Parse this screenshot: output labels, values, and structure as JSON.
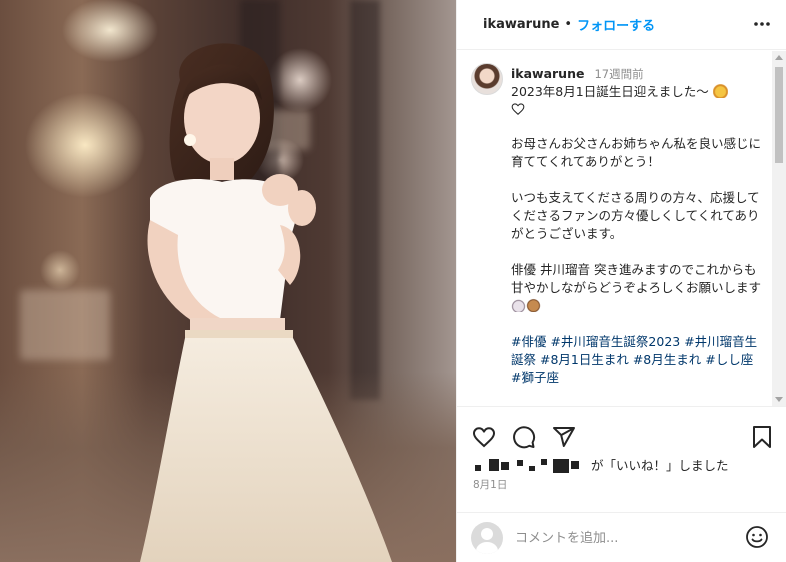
{
  "photo": {
    "alt_subject": "photo"
  },
  "header": {
    "username": "ikawarune",
    "separator": "•",
    "follow_label": "フォローする"
  },
  "caption": {
    "username": "ikawarune",
    "time": "17週間前",
    "lines": [
      "2023年8月1日誕生日迎えました〜",
      "お母さんお父さんお姉ちゃん私を良い感じに育ててくれてありがとう！",
      "いつも支えてくださる周りの方々、応援してくださるファンの方々優しくしてくれてありがとうございます。",
      "俳優 井川瑠音 突き進みますのでこれからも甘やかしながらどうぞよろしくお願いします"
    ],
    "hashtags": "#俳優 #井川瑠音生誕祭2023 #井川瑠音生誕祭 #8月1日生まれ #8月生まれ #しし座 #獅子座"
  },
  "likes": {
    "suffix": "が「いいね！」しました"
  },
  "date": "8月1日",
  "comment": {
    "placeholder": "コメントを追加..."
  },
  "icons": [
    "more-icon",
    "heart-icon",
    "comment-icon",
    "share-icon",
    "bookmark-icon",
    "emoji-icon"
  ]
}
